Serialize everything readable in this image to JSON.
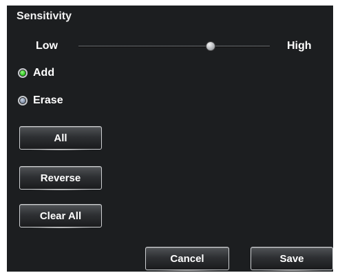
{
  "sensitivity": {
    "title": "Sensitivity",
    "low_label": "Low",
    "high_label": "High",
    "value_fraction": 0.69
  },
  "mode": {
    "options": [
      {
        "label": "Add",
        "selected": true
      },
      {
        "label": "Erase",
        "selected": false
      }
    ]
  },
  "actions": {
    "all_label": "All",
    "reverse_label": "Reverse",
    "clear_all_label": "Clear All"
  },
  "footer": {
    "cancel_label": "Cancel",
    "save_label": "Save"
  },
  "colors": {
    "panel_background": "#1c1e20",
    "selected_radio": "#2fcb21",
    "unselected_radio": "#7f8ea6"
  }
}
